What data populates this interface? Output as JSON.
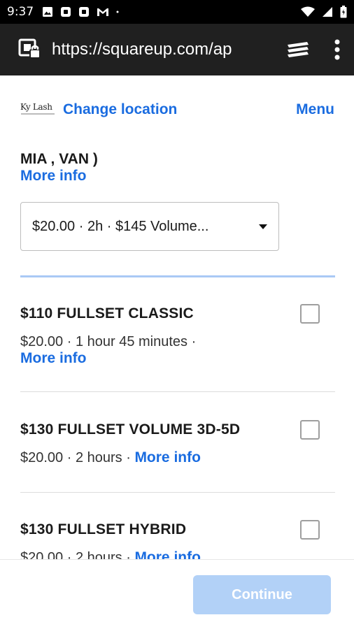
{
  "status_bar": {
    "time": "9:37",
    "left_icons": [
      "image-icon",
      "square-app-icon",
      "square-app-icon",
      "gmail-icon",
      "dot-icon"
    ],
    "right_icons": [
      "wifi-icon",
      "signal-icon",
      "battery-icon"
    ]
  },
  "browser": {
    "url": "https://squareup.com/ap",
    "icons": [
      "page-info-icon",
      "tabs-icon",
      "overflow-menu-icon"
    ]
  },
  "header": {
    "logo_text": "Ky Lash",
    "change_location": "Change location",
    "menu": "Menu"
  },
  "staff": {
    "name": "MIA , VAN )",
    "more_info": "More info",
    "selected_option": "$20.00 · 2h · $145 Volume..."
  },
  "services": [
    {
      "title": "$110 FULLSET CLASSIC",
      "meta": "$20.00 · 1 hour 45 minutes ·",
      "more_info": "More info",
      "checked": false
    },
    {
      "title": "$130 FULLSET VOLUME 3D-5D",
      "meta": "$20.00 · 2 hours ·",
      "more_info": "More info",
      "checked": false
    },
    {
      "title": "$130 FULLSET HYBRID",
      "meta": "$20.00 · 2 hours ·",
      "more_info": "More info",
      "checked": false
    }
  ],
  "footer": {
    "continue_label": "Continue"
  },
  "colors": {
    "link": "#1a6ce0",
    "continue_disabled": "#b2d1f7",
    "toolbar": "#202020"
  }
}
